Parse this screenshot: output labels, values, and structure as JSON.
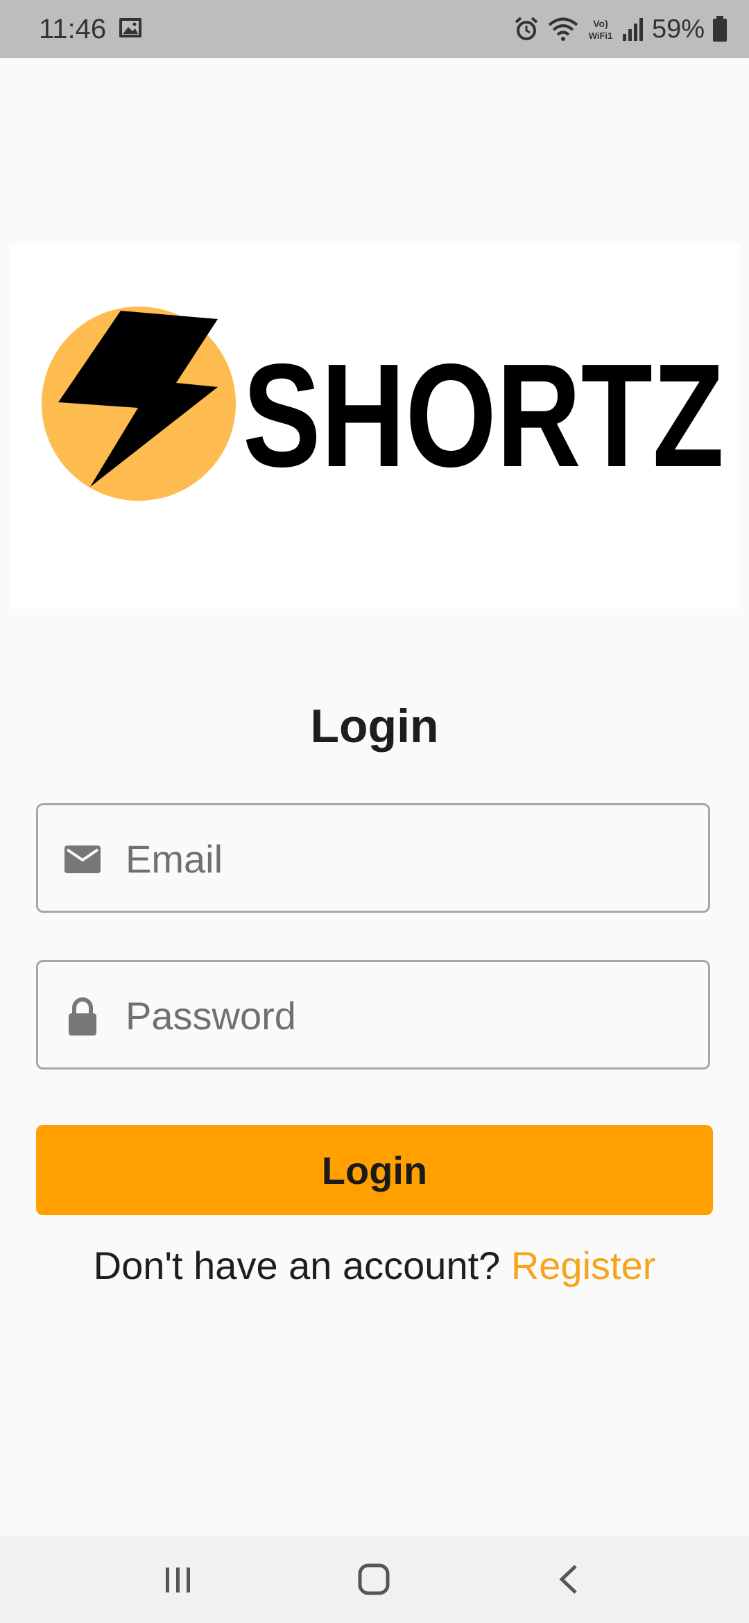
{
  "status_bar": {
    "time": "11:46",
    "battery": "59%",
    "icons": [
      "gallery-icon",
      "alarm-icon",
      "wifi-icon",
      "vowifi-icon",
      "signal-icon",
      "battery-icon"
    ]
  },
  "logo": {
    "brand_text": "SHORTZ",
    "circle_color": "#fdbb50",
    "bolt_color": "#000000"
  },
  "login": {
    "title": "Login",
    "email_placeholder": "Email",
    "email_value": "",
    "password_placeholder": "Password",
    "password_value": "",
    "button_label": "Login",
    "button_color": "#ffa000"
  },
  "register": {
    "prompt": "Don't have an account? ",
    "link_label": "Register",
    "link_color": "#f5a41c"
  },
  "nav": {
    "items": [
      "recents-icon",
      "home-icon",
      "back-icon"
    ]
  }
}
